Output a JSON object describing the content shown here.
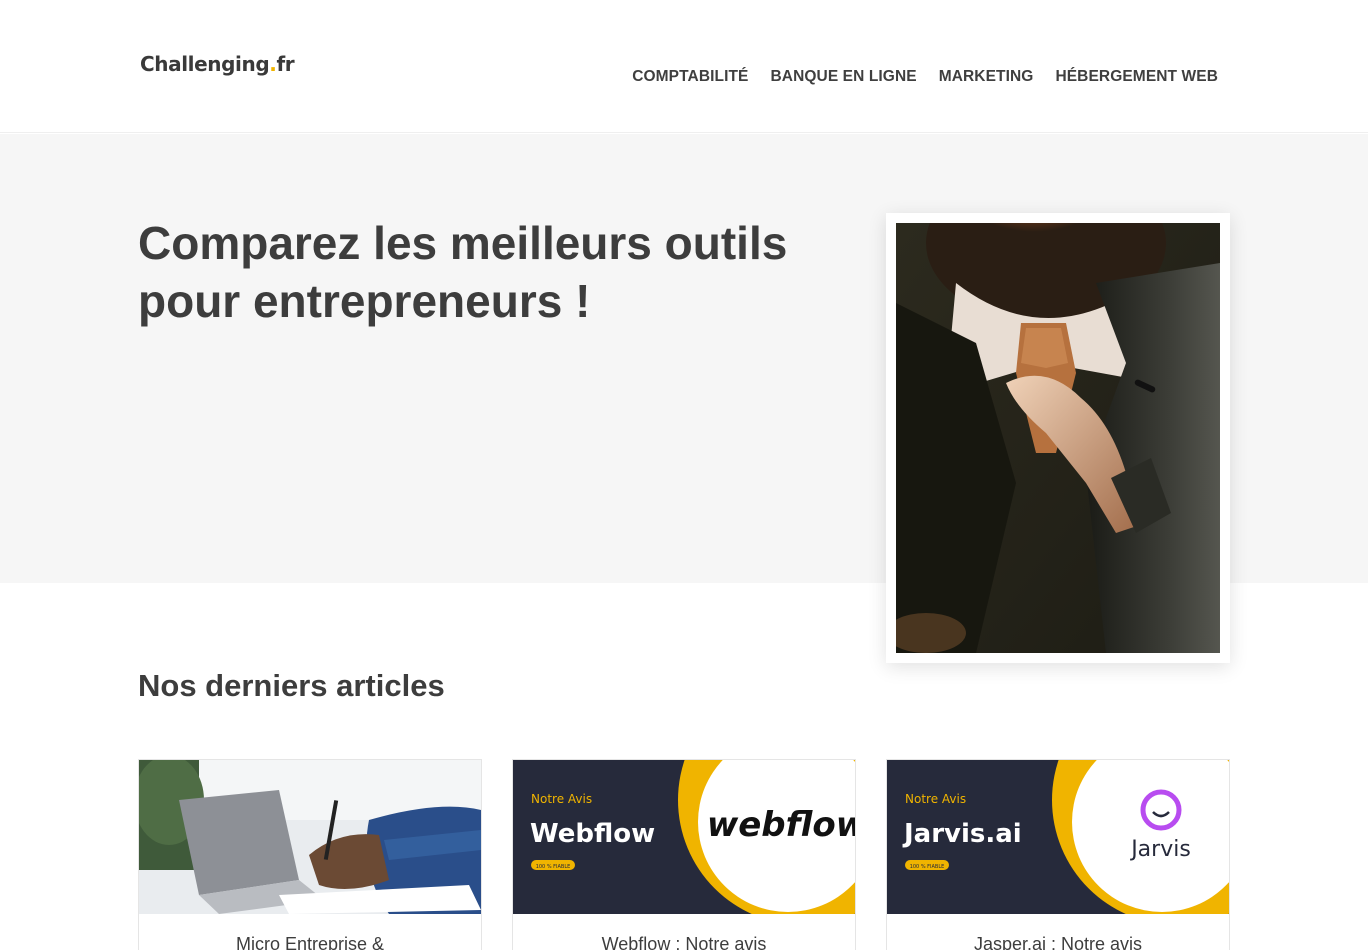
{
  "header": {
    "logo_main": "Challenging",
    "logo_dot": ".",
    "logo_tld": "fr",
    "nav": [
      {
        "label": "COMPTABILITÉ"
      },
      {
        "label": "BANQUE EN LIGNE"
      },
      {
        "label": "MARKETING"
      },
      {
        "label": "HÉBERGEMENT WEB"
      }
    ]
  },
  "hero": {
    "title_line1": "Comparez les meilleurs outils",
    "title_line2": "pour entrepreneurs !"
  },
  "articles": {
    "section_title": "Nos derniers articles",
    "cards": [
      {
        "title": "Micro Entreprise &"
      },
      {
        "title": "Webflow : Notre avis",
        "thumb_tag": "Notre Avis",
        "thumb_name": "Webflow",
        "thumb_badge": "100 % FIABLE",
        "thumb_logo": "webflow"
      },
      {
        "title": "Jasper.ai : Notre avis",
        "thumb_tag": "Notre Avis",
        "thumb_name": "Jarvis.ai",
        "thumb_badge": "100 % FIABLE",
        "thumb_logo": "Jarvis"
      }
    ]
  },
  "colors": {
    "accent": "#f0b400",
    "dark_navy": "#262a3b",
    "hero_bg": "#f6f6f6",
    "text": "#3d3d3d"
  }
}
